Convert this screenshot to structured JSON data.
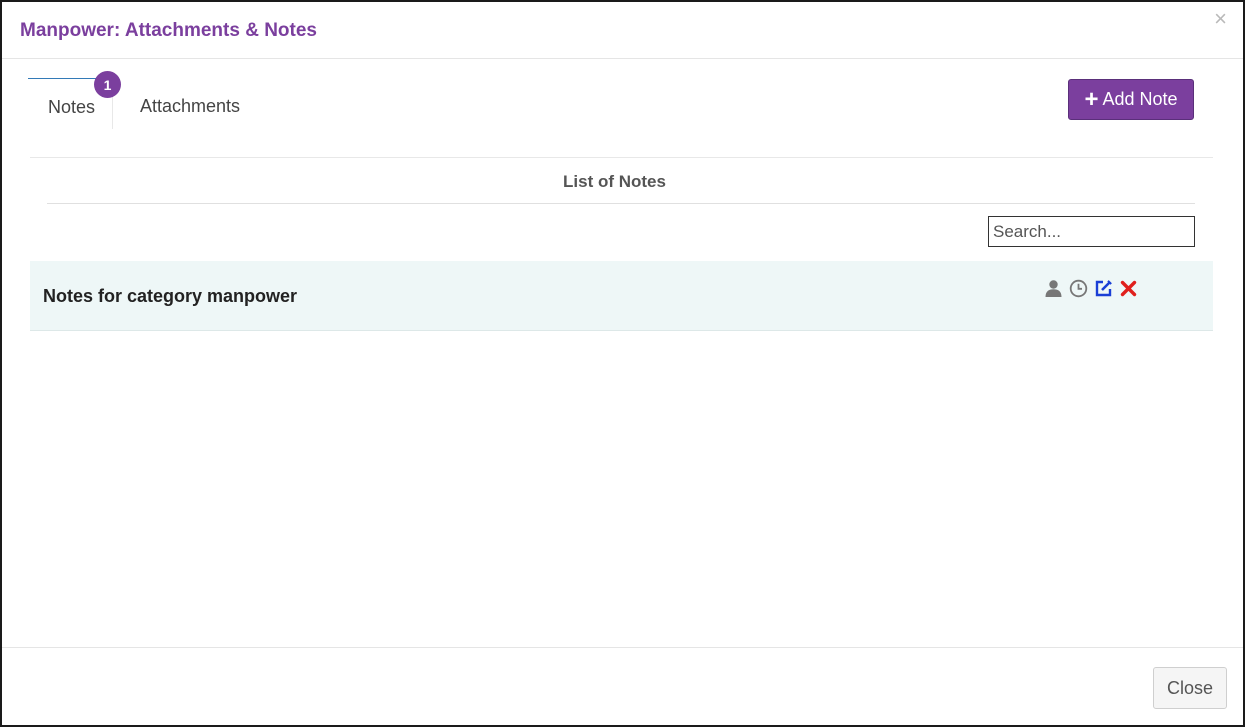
{
  "modal": {
    "title": "Manpower: Attachments & Notes",
    "close_icon": "×"
  },
  "tabs": [
    {
      "label": "Notes",
      "badge": "1",
      "active": true
    },
    {
      "label": "Attachments",
      "active": false
    }
  ],
  "add_note_button": {
    "icon": "plus-icon",
    "label": "Add Note"
  },
  "list": {
    "title": "List of Notes",
    "search_placeholder": "Search...",
    "notes": [
      {
        "text": "Notes for category manpower",
        "actions": [
          "user-icon",
          "clock-icon",
          "edit-icon",
          "delete-icon"
        ]
      }
    ]
  },
  "footer": {
    "close_label": "Close"
  },
  "colors": {
    "accent": "#7b3f9e",
    "row_bg": "#eef7f7",
    "edit": "#1a3fd6",
    "delete": "#e0201d",
    "icon_gray": "#777777"
  }
}
